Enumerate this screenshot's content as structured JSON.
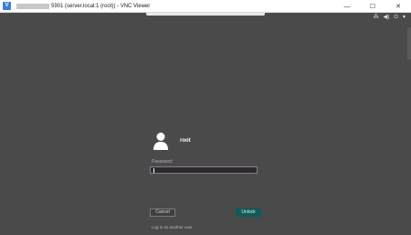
{
  "window": {
    "title": "5901 (server.local:1 (root)) - VNC Viewer",
    "minimize_glyph": "—",
    "maximize_glyph": "☐",
    "close_glyph": "✕",
    "app_icon_glyph": "V"
  },
  "status_icons": [
    {
      "name": "network-icon",
      "glyph": "⁂"
    },
    {
      "name": "volume-icon",
      "glyph": "◀)"
    },
    {
      "name": "power-icon",
      "glyph": "⏻"
    },
    {
      "name": "chevron-down-icon",
      "glyph": "▾"
    }
  ],
  "lock": {
    "username": "root",
    "password_label": "Password:",
    "password_value": "",
    "cancel_label": "Cancel",
    "unlock_label": "Unlock",
    "alt_login_label": "Log in as another user"
  },
  "colors": {
    "background": "#4a4a4a",
    "unlock_button": "#0f5a5a",
    "input_border": "#8a7a96",
    "app_icon": "#3b7fd9"
  }
}
